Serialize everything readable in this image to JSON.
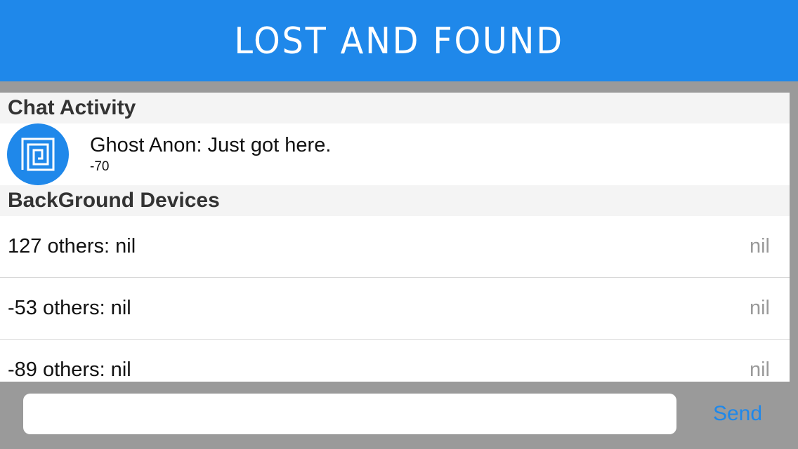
{
  "theme": {
    "accent": "#1f88ea"
  },
  "header": {
    "title": "LOST AND FOUND"
  },
  "sections": {
    "chat": {
      "title": "Chat Activity",
      "items": [
        {
          "message": "Ghost Anon: Just got here.",
          "subtitle": "-70",
          "avatar_icon": "spiral-square-icon"
        }
      ]
    },
    "devices": {
      "title": "BackGround Devices",
      "items": [
        {
          "label": "127  others: nil",
          "detail": "nil"
        },
        {
          "label": "-53  others: nil",
          "detail": "nil"
        },
        {
          "label": "-89  others: nil",
          "detail": "nil"
        }
      ]
    }
  },
  "composer": {
    "placeholder": "",
    "value": "",
    "send_label": "Send"
  }
}
